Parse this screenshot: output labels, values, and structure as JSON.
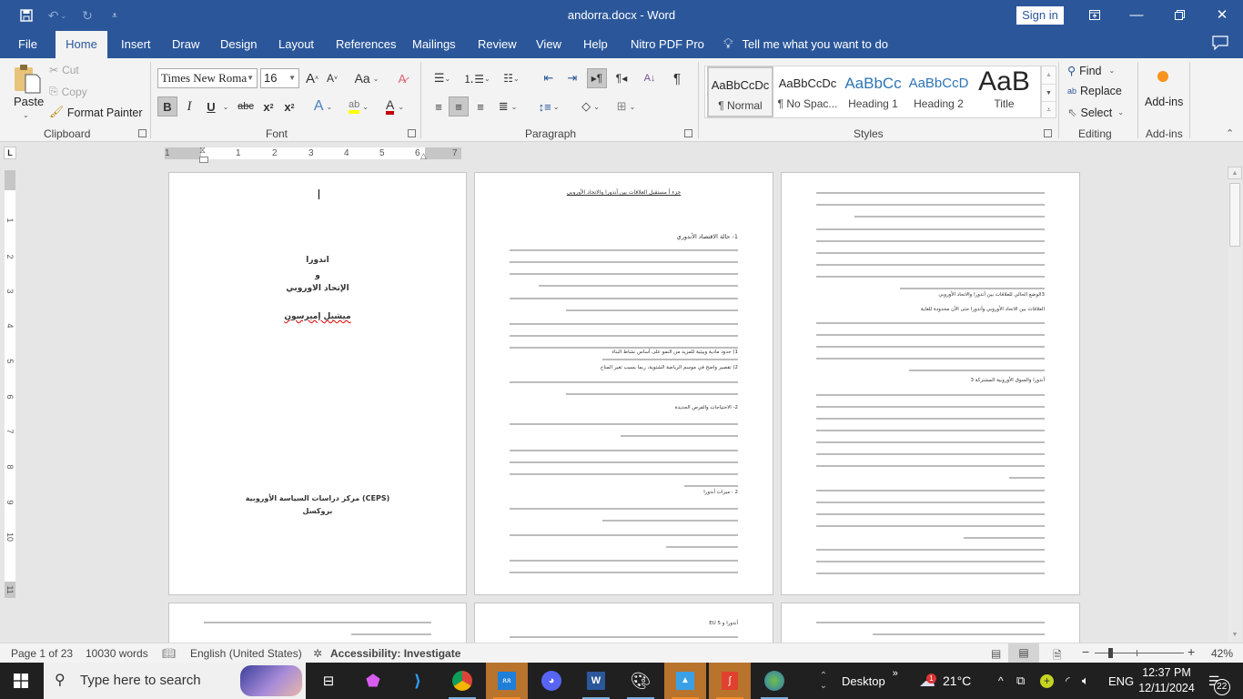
{
  "titlebar": {
    "title": "andorra.docx  -  Word",
    "sign_in": "Sign in",
    "icons": {
      "save": "save-icon",
      "undo": "undo-icon",
      "redo": "redo-icon",
      "customize": "customize-qat-icon"
    }
  },
  "tabs": [
    "File",
    "Home",
    "Insert",
    "Draw",
    "Design",
    "Layout",
    "References",
    "Mailings",
    "Review",
    "View",
    "Help",
    "Nitro PDF Pro"
  ],
  "active_tab": "Home",
  "tell_me": "Tell me what you want to do",
  "clipboard": {
    "paste": "Paste",
    "cut": "Cut",
    "copy": "Copy",
    "format_painter": "Format Painter",
    "label": "Clipboard"
  },
  "font": {
    "name": "Times New Roma",
    "size": "16",
    "label": "Font",
    "case": "Aa"
  },
  "paragraph": {
    "label": "Paragraph"
  },
  "styles": {
    "label": "Styles",
    "items": [
      {
        "preview": "AaBbCcDc",
        "name": "¶ Normal"
      },
      {
        "preview": "AaBbCcDc",
        "name": "¶ No Spac..."
      },
      {
        "preview": "AaBbCc",
        "name": "Heading 1"
      },
      {
        "preview": "AaBbCcD",
        "name": "Heading 2"
      },
      {
        "preview": "AaB",
        "name": "Title"
      }
    ]
  },
  "editing": {
    "find": "Find",
    "replace": "Replace",
    "select": "Select",
    "label": "Editing"
  },
  "addins": {
    "button": "Add-ins",
    "label": "Add-ins"
  },
  "ruler": {
    "h_numbers": [
      "1",
      "1",
      "2",
      "3",
      "4",
      "5",
      "6",
      "7"
    ],
    "v_numbers": [
      "1",
      "2",
      "3",
      "4",
      "5",
      "6",
      "7",
      "8",
      "9",
      "10",
      "11"
    ]
  },
  "pages": {
    "p1": {
      "title1": "اندورا",
      "title2": "و",
      "title3": "الإتحاد الاوروبي",
      "author": "ميشيل إميرسون",
      "org": "(CEPS) مركز دراسات السياسة الأوروبية",
      "city": "بروكسل"
    },
    "p2": {
      "heading": "جزء أ مستقبل العلاقات بين أندورا والاتحاد الأوروبي",
      "section1": "1- حالة الاقتصاد الأندوري",
      "list1": "1) حدود مادية وبيئية للمزيد من النمو على أساس نشاط البناء",
      "list2": "2) تقصير واضح في موسم الرياضة الشتوية، ربما بسبب تغير المناخ",
      "section2": "2- الاحتياجات والفرص الجديدة",
      "section3": "2 : ميزات أندورا"
    },
    "p3": {
      "section": "3الوضع الحالي للعلاقات بين أندورا والاتحاد الأوروبي",
      "sub": "العلاقات بين الاتحاد الأوروبي وأندورا حتى الآن محدودة للغاية",
      "sub2": "أندورا والسوق الأوروبية المشتركة 3"
    },
    "p5": {
      "heading": "أندورا و EU 5"
    }
  },
  "status": {
    "page": "Page 1 of 23",
    "words": "10030 words",
    "language": "English (United States)",
    "accessibility": "Accessibility: Investigate",
    "zoom": "42%",
    "zoom_level_percent": 42
  },
  "taskbar": {
    "search_placeholder": "Type here to search",
    "desktop": "Desktop",
    "weather": "21°C",
    "language": "ENG",
    "time": "12:37 PM",
    "date": "12/11/2024",
    "notifications": "22",
    "weather_badge": "1"
  }
}
